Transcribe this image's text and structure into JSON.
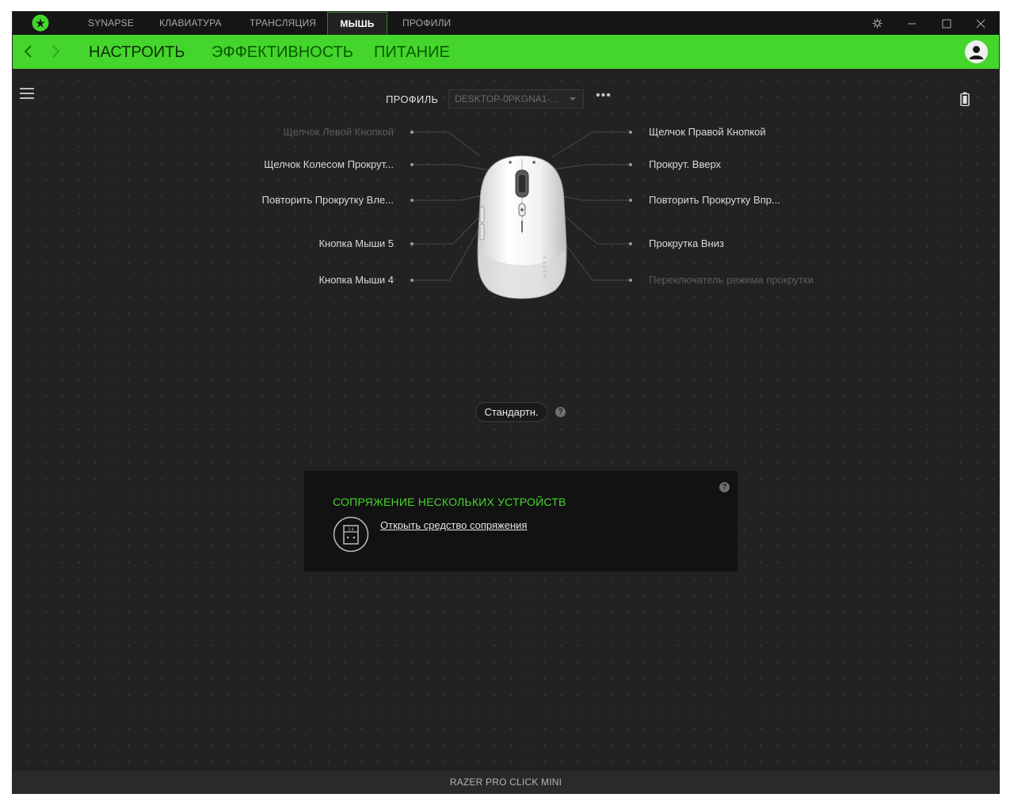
{
  "titlebar": {
    "tabs": [
      {
        "label": "SYNAPSE"
      },
      {
        "label": "КЛАВИАТУРА"
      },
      {
        "label": "ТРАНСЛЯЦИЯ"
      },
      {
        "label": "МЫШЬ",
        "active": true
      },
      {
        "label": "ПРОФИЛИ"
      }
    ],
    "icons": [
      "razer-logo-icon",
      "settings-icon",
      "minimize-icon",
      "maximize-icon",
      "close-icon"
    ]
  },
  "subnav": {
    "tabs": [
      {
        "label": "НАСТРОИТЬ",
        "active": true
      },
      {
        "label": "ЭФФЕКТИВНОСТЬ"
      },
      {
        "label": "ПИТАНИЕ"
      }
    ]
  },
  "profile": {
    "label": "ПРОФИЛЬ",
    "selected": "DESKTOP-0PKGNA1-...",
    "more": "•••"
  },
  "buttons_left": [
    {
      "label": "Щелчок Левой Кнопкой",
      "dim": true
    },
    {
      "label": "Щелчок Колесом Прокрут..."
    },
    {
      "label": "Повторить Прокрутку Вле..."
    },
    {
      "label": "Кнопка Мыши 5"
    },
    {
      "label": "Кнопка Мыши 4"
    }
  ],
  "buttons_right": [
    {
      "label": "Щелчок Правой Кнопкой"
    },
    {
      "label": "Прокрут. Вверх"
    },
    {
      "label": "Повторить Прокрутку Впр..."
    },
    {
      "label": "Прокрутка Вниз"
    },
    {
      "label": "Переключатель режима прокрутки",
      "dim": true
    }
  ],
  "mode": {
    "label": "Стандартн.",
    "help": "?"
  },
  "pairing": {
    "title": "СОПРЯЖЕНИЕ НЕСКОЛЬКИХ УСТРОЙСТВ",
    "link": "Открыть средство сопряжения",
    "icon_text": "2.4",
    "help": "?"
  },
  "device_name": "RAZER PRO CLICK MINI",
  "colors": {
    "accent": "#44d62c",
    "background": "#222222",
    "panel": "#121212"
  }
}
